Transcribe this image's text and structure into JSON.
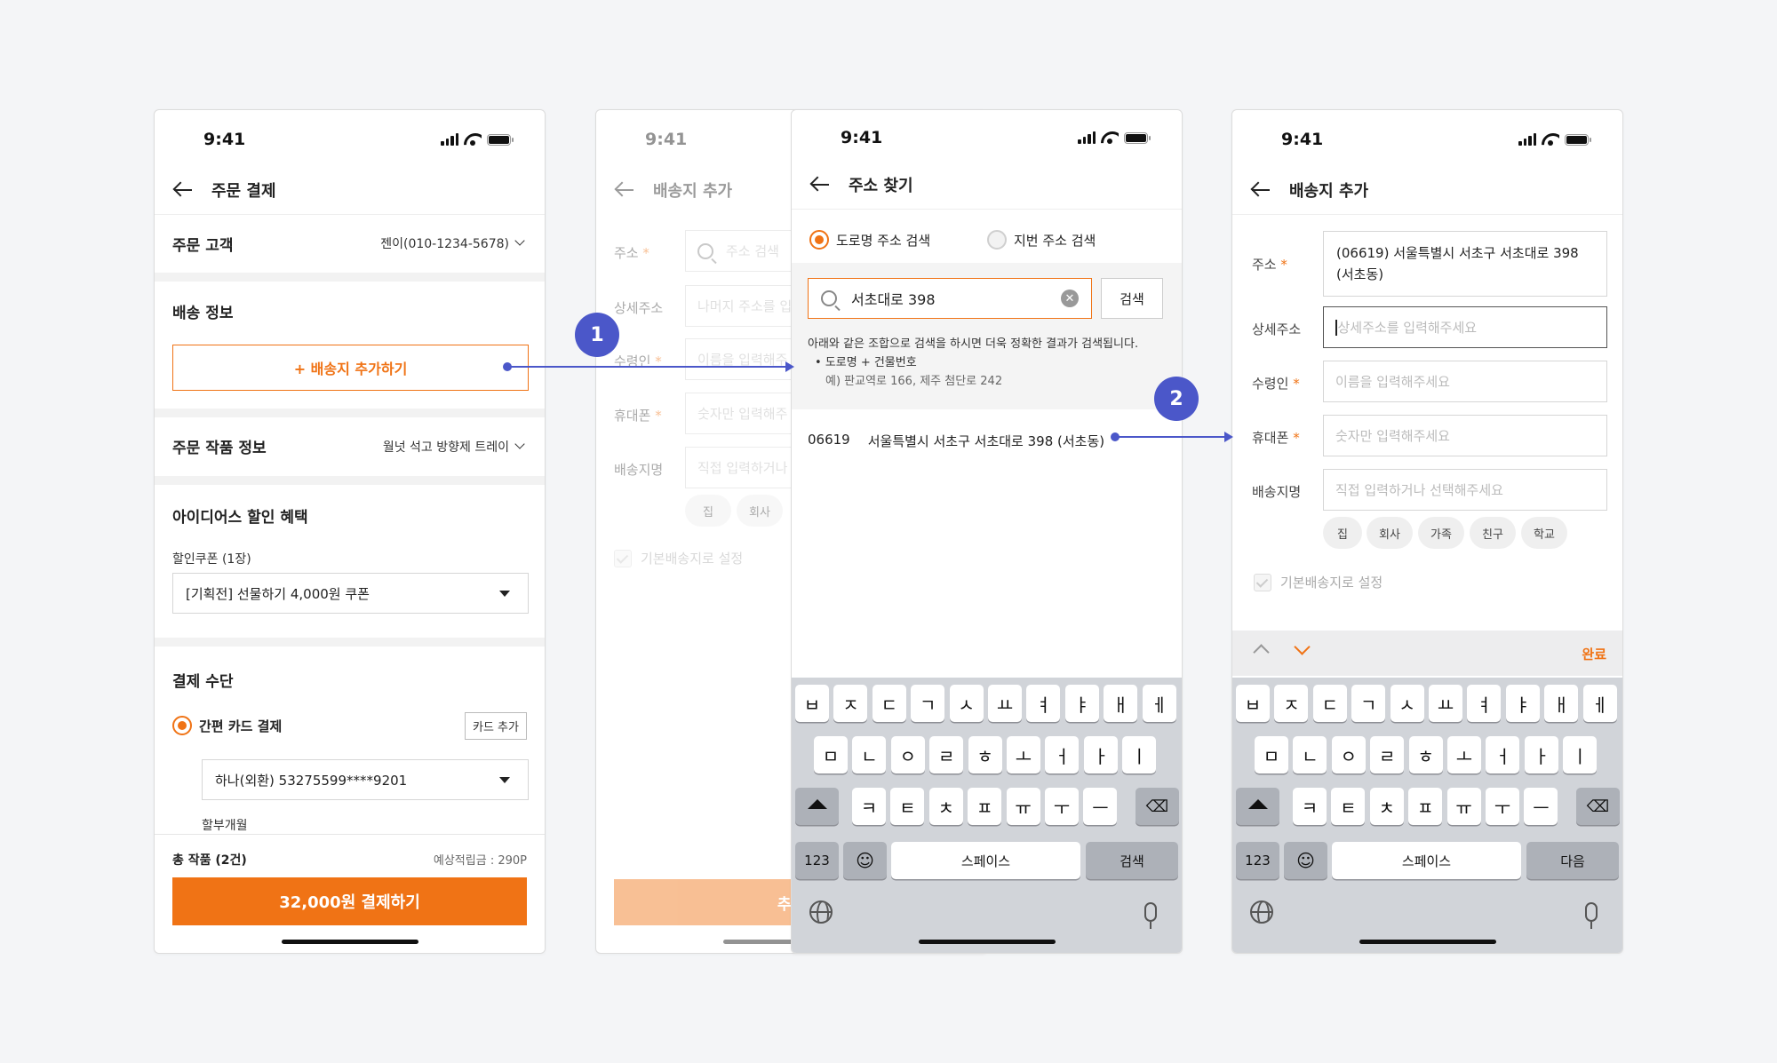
{
  "status_time": "9:41",
  "s1": {
    "title": "주문 결제",
    "customer_label": "주문 고객",
    "customer_value": "젠이(010-1234-5678)",
    "shipping_label": "배송 정보",
    "add_address_btn": "+ 배송지 추가하기",
    "product_label": "주문 작품 정보",
    "product_value": "월넛 석고 방향제 트레이",
    "discount_label": "아이디어스 할인 혜택",
    "coupon_label": "할인쿠폰 (1장)",
    "coupon_value": "[기획전] 선물하기 4,000원 쿠폰",
    "payment_label": "결제 수단",
    "pay_method": "간편 카드 결제",
    "add_card_btn": "카드 추가",
    "card_value": "하나(외환) 53275599****9201",
    "installment_label": "할부개월",
    "total_label": "총 작품 (2건)",
    "points": "예상적립금 : 290P",
    "pay_btn": "32,000원 결제하기"
  },
  "s2": {
    "title": "배송지 추가",
    "addr_label": "주소",
    "addr_ph": "주소 검색",
    "detail_label": "상세주소",
    "detail_ph": "나머지 주소를 입",
    "recv_label": "수령인",
    "recv_ph": "이름을 입력해주",
    "phone_label": "휴대폰",
    "phone_ph": "숫자만 입력해주",
    "name_label": "배송지명",
    "name_ph": "직접 입력하거나",
    "chips": [
      "집",
      "회사"
    ],
    "default_label": "기본배송지로 설정",
    "add_btn": "추가"
  },
  "s3": {
    "title": "주소 찾기",
    "opt_road": "도로명 주소 검색",
    "opt_lot": "지번 주소 검색",
    "search_value": "서초대로 398",
    "search_btn": "검색",
    "hint": "아래와 같은 조합으로 검색을 하시면 더욱 정확한 결과가 검색됩니다.",
    "hint_item": "도로명 + 건물번호",
    "hint_example": "예) 판교역로 166,  제주 첨단로 242",
    "result_zip": "06619",
    "result_addr": "서울특별시 서초구 서초대로 398 (서초동)",
    "kb_enter": "검색"
  },
  "s4": {
    "title": "배송지 추가",
    "addr_label": "주소",
    "addr_value": "(06619) 서울특별시 서초구 서초대로 398 (서초동)",
    "detail_label": "상세주소",
    "detail_ph": "상세주소를 입력해주세요",
    "recv_label": "수령인",
    "recv_ph": "이름을 입력해주세요",
    "phone_label": "휴대폰",
    "phone_ph": "숫자만 입력해주세요",
    "name_label": "배송지명",
    "name_ph": "직접 입력하거나 선택해주세요",
    "chips": [
      "집",
      "회사",
      "가족",
      "친구",
      "학교"
    ],
    "default_label": "기본배송지로 설정",
    "done": "완료",
    "kb_enter": "다음"
  },
  "kb": {
    "row1": [
      "ㅂ",
      "ㅈ",
      "ㄷ",
      "ㄱ",
      "ㅅ",
      "ㅛ",
      "ㅕ",
      "ㅑ",
      "ㅐ",
      "ㅔ"
    ],
    "row2": [
      "ㅁ",
      "ㄴ",
      "ㅇ",
      "ㄹ",
      "ㅎ",
      "ㅗ",
      "ㅓ",
      "ㅏ",
      "ㅣ"
    ],
    "row3": [
      "ㅋ",
      "ㅌ",
      "ㅊ",
      "ㅍ",
      "ㅠ",
      "ㅜ",
      "ㅡ"
    ],
    "num": "123",
    "emoji": "☺",
    "space": "스페이스"
  },
  "req_mark": "*",
  "badges": [
    "1",
    "2"
  ],
  "colors": {
    "accent": "#f07315",
    "connector": "#4b57c9"
  }
}
